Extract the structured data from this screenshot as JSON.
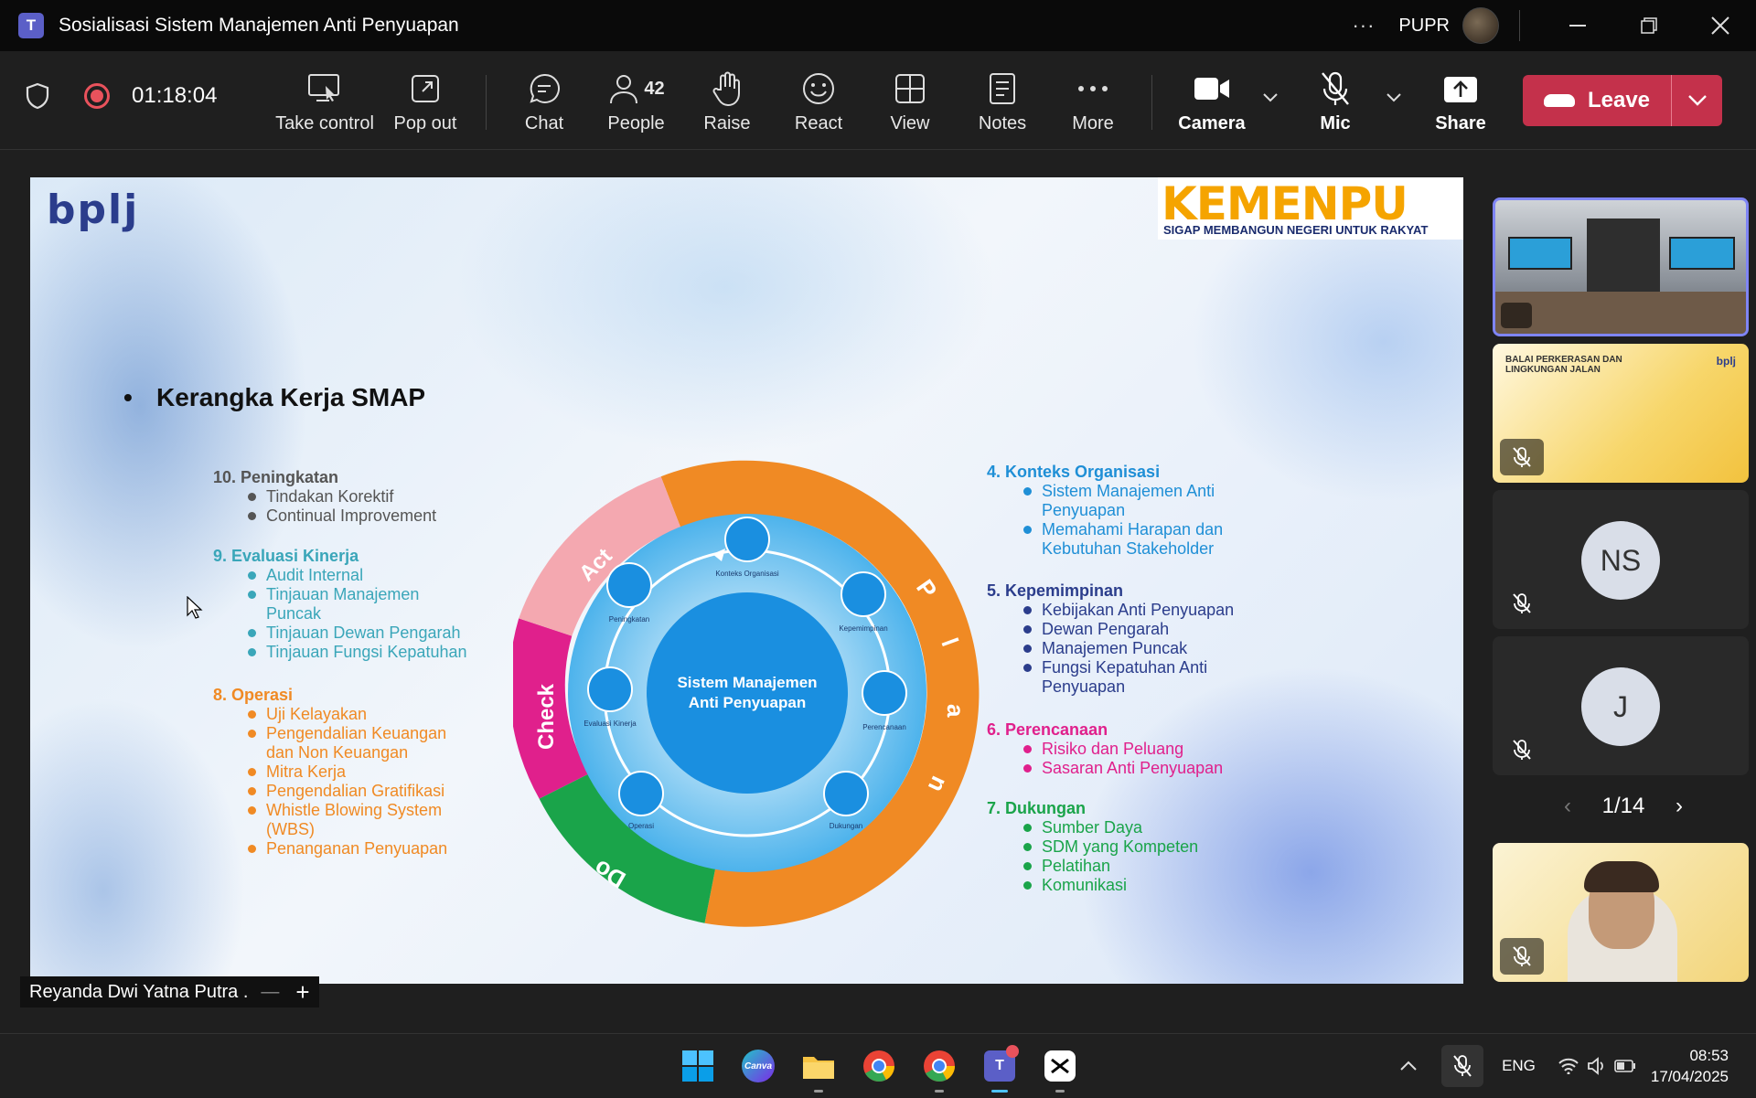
{
  "window": {
    "title": "Sosialisasi Sistem Manajemen Anti Penyuapan",
    "org": "PUPR",
    "more": "···"
  },
  "toolbar": {
    "timer": "01:18:04",
    "take_control": "Take control",
    "pop_out": "Pop out",
    "chat": "Chat",
    "people": "People",
    "people_count": "42",
    "raise": "Raise",
    "react": "React",
    "view": "View",
    "notes": "Notes",
    "more": "More",
    "camera": "Camera",
    "mic": "Mic",
    "share": "Share",
    "leave": "Leave"
  },
  "slide": {
    "logo": "bplj",
    "brand": "KEMENPU",
    "brand_tagline": "SIGAP MEMBANGUN NEGERI UNTUK RAKYAT",
    "title": "Kerangka Kerja SMAP",
    "left_sections": [
      {
        "heading": "10. Peningkatan",
        "color": "#555555",
        "items": [
          "Tindakan Korektif",
          "Continual Improvement"
        ]
      },
      {
        "heading": "9. Evaluasi Kinerja",
        "color": "#3aa6b9",
        "items": [
          "Audit Internal",
          "Tinjauan Manajemen Puncak",
          "Tinjauan Dewan Pengarah",
          "Tinjauan Fungsi Kepatuhan"
        ]
      },
      {
        "heading": "8. Operasi",
        "color": "#f08a24",
        "items": [
          "Uji Kelayakan",
          "Pengendalian Keuangan dan Non Keuangan",
          "Mitra Kerja",
          "Pengendalian Gratifikasi",
          "Whistle Blowing System (WBS)",
          "Penanganan Penyuapan"
        ]
      }
    ],
    "right_sections": [
      {
        "heading": "4.  Konteks Organisasi",
        "color": "#1f8fd6",
        "items": [
          "Sistem Manajemen Anti Penyuapan",
          "Memahami Harapan dan Kebutuhan Stakeholder"
        ]
      },
      {
        "heading": "5. Kepemimpinan",
        "color": "#2b3d8c",
        "items": [
          "Kebijakan Anti Penyuapan",
          "Dewan Pengarah",
          "Manajemen Puncak",
          "Fungsi Kepatuhan Anti Penyuapan"
        ]
      },
      {
        "heading": "6. Perencanaan",
        "color": "#e0208c",
        "items": [
          "Risiko dan Peluang",
          "Sasaran Anti Penyuapan"
        ]
      },
      {
        "heading": "7. Dukungan",
        "color": "#1aa44a",
        "items": [
          "Sumber Daya",
          "SDM yang Kompeten",
          "Pelatihan",
          "Komunikasi"
        ]
      }
    ],
    "diagram": {
      "center_line1": "Sistem Manajemen",
      "center_line2": "Anti Penyuapan",
      "ring_labels": {
        "plan_p": "P",
        "plan_l": "l",
        "plan_a": "a",
        "plan_n": "n",
        "do": "Do",
        "check": "Check",
        "act": "Act"
      },
      "nodes": [
        "Konteks Organisasi",
        "Kepemimpinan",
        "Perencanaan",
        "Dukungan",
        "Operasi",
        "Evaluasi Kinerja",
        "Peningkatan"
      ],
      "colors": {
        "plan": "#f08a24",
        "do": "#1aa44a",
        "check": "#e0208c",
        "act": "#f4a8b0",
        "inner": "#4db3ec",
        "center": "#1a8fe0"
      }
    }
  },
  "rail": {
    "tiles": [
      {
        "kind": "video-room"
      },
      {
        "kind": "banner",
        "banner_text": "BALAI PERKERASAN DAN LINGKUNGAN JALAN",
        "logo": "bplj"
      },
      {
        "kind": "avatar",
        "initials": "NS"
      },
      {
        "kind": "avatar",
        "initials": "J"
      },
      {
        "kind": "video-person"
      }
    ],
    "page": "1/14"
  },
  "presenter_name": "Reyanda Dwi Yatna Putra .",
  "taskbar": {
    "language": "ENG",
    "time": "08:53",
    "date": "17/04/2025",
    "apps": [
      "windows-start",
      "canva",
      "file-explorer",
      "chrome",
      "chrome",
      "teams",
      "capcut"
    ],
    "canva_label": "Canva"
  }
}
